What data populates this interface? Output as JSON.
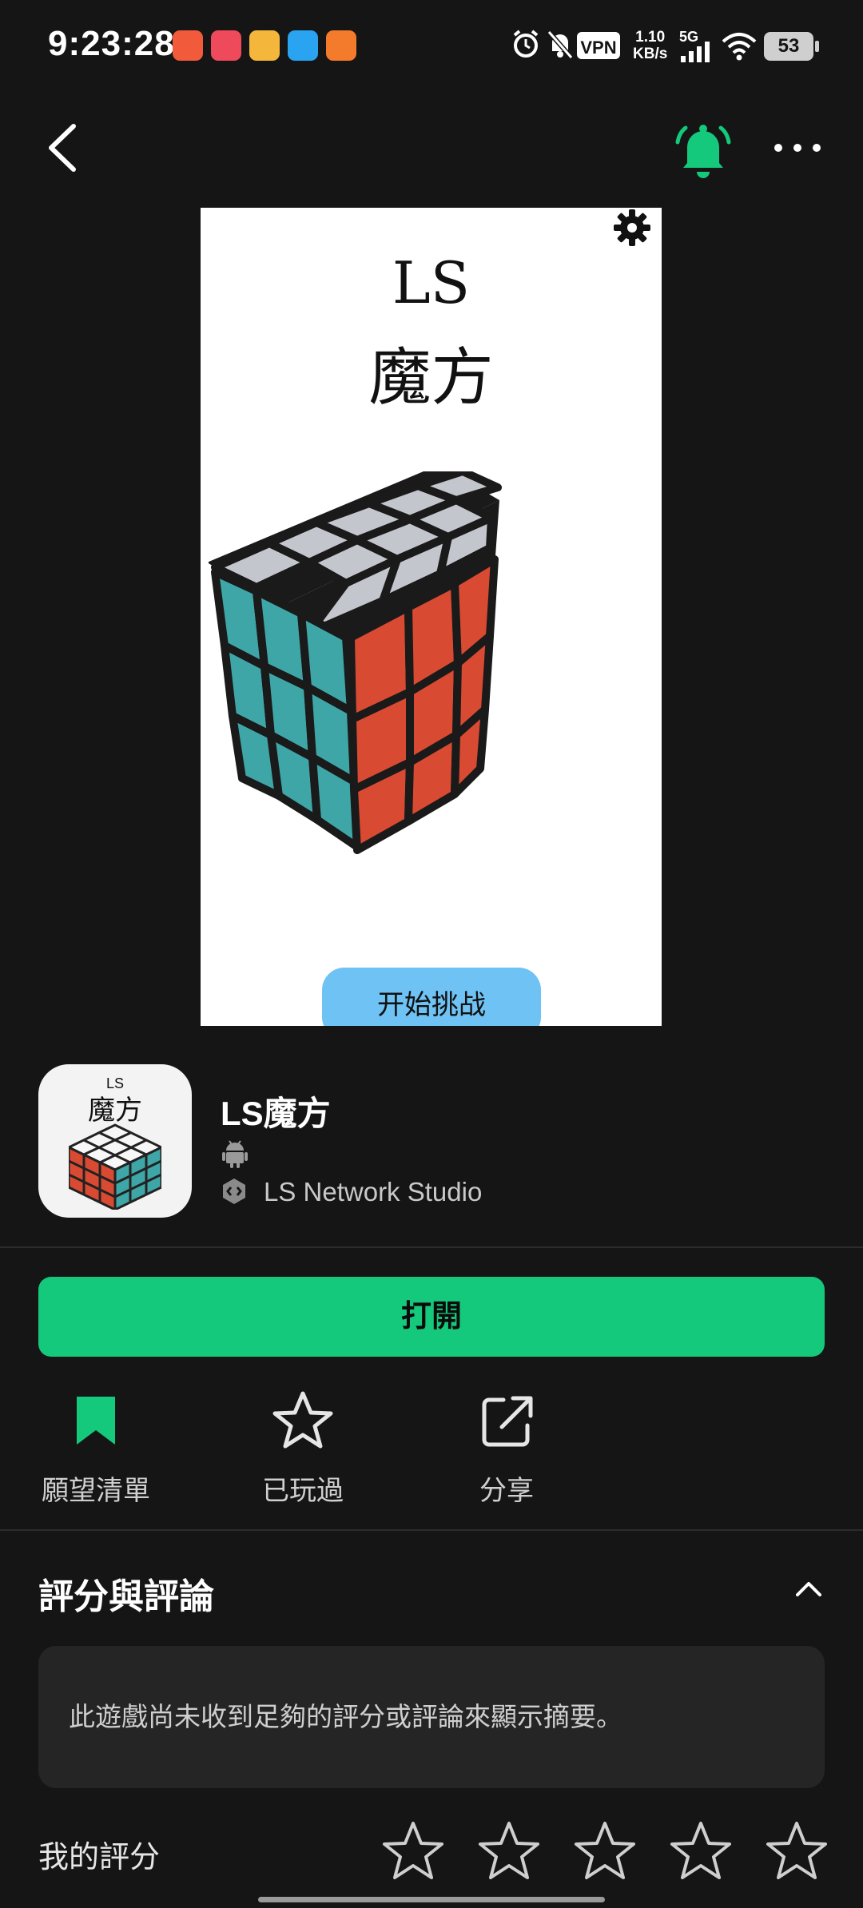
{
  "status_bar": {
    "time": "9:23:28",
    "vpn": "VPN",
    "speed_value": "1.10",
    "speed_unit": "KB/s",
    "network": "5G",
    "battery": "53"
  },
  "screenshot": {
    "title_line1": "LS",
    "title_line2": "魔方",
    "start_button": "开始挑战",
    "pager_count": 3
  },
  "app": {
    "icon_text_small": "LS",
    "icon_text_large": "魔方",
    "name": "LS魔方",
    "developer": "LS Network Studio"
  },
  "open_button": "打開",
  "actions": [
    {
      "label": "願望清單"
    },
    {
      "label": "已玩過"
    },
    {
      "label": "分享"
    }
  ],
  "ratings": {
    "section_title": "評分與評論",
    "summary": "此遊戲尚未收到足夠的評分或評論來顯示摘要。",
    "my_rating_label": "我的評分",
    "my_rating_value": 0,
    "max_stars": 5
  },
  "colors": {
    "accent": "#14c97b",
    "background": "#151515",
    "card": "#252525"
  }
}
